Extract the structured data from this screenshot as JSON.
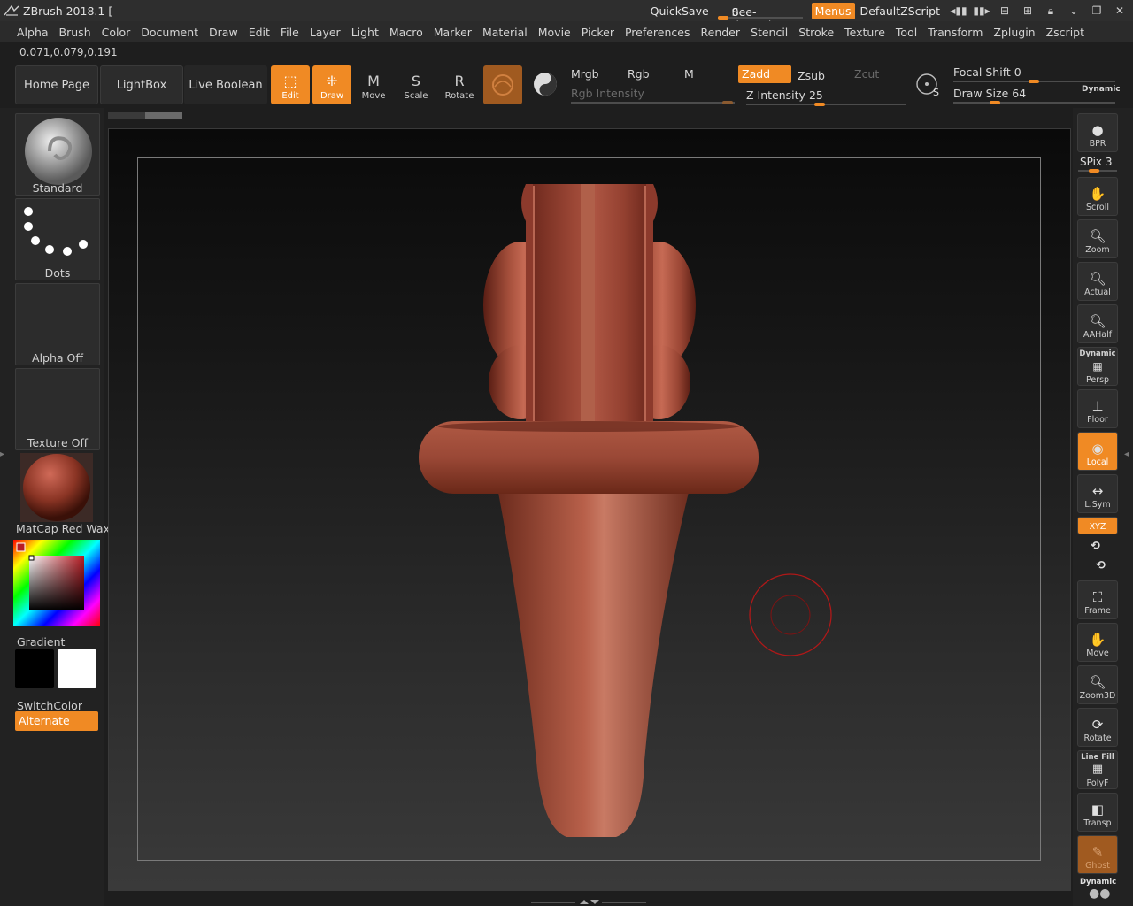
{
  "titlebar": {
    "title": "ZBrush 2018.1 [",
    "quicksave": "QuickSave",
    "seethrough_label": "See-through",
    "seethrough_value": "0",
    "menus": "Menus",
    "script": "DefaultZScript"
  },
  "menubar": [
    "Alpha",
    "Brush",
    "Color",
    "Document",
    "Draw",
    "Edit",
    "File",
    "Layer",
    "Light",
    "Macro",
    "Marker",
    "Material",
    "Movie",
    "Picker",
    "Preferences",
    "Render",
    "Stencil",
    "Stroke",
    "Texture",
    "Tool",
    "Transform",
    "Zplugin",
    "Zscript"
  ],
  "coords": "0.071,0.079,0.191",
  "shelf": {
    "home_page": "Home Page",
    "lightbox": "LightBox",
    "live_boolean": "Live Boolean",
    "edit": "Edit",
    "draw": "Draw",
    "move": "Move",
    "scale": "Scale",
    "rotate": "Rotate",
    "mrgb": "Mrgb",
    "rgb": "Rgb",
    "m": "M",
    "rgb_intensity": "Rgb Intensity",
    "zadd": "Zadd",
    "zsub": "Zsub",
    "zcut": "Zcut",
    "z_intensity_label": "Z Intensity",
    "z_intensity_value": "25",
    "focal_shift_label": "Focal Shift",
    "focal_shift_value": "0",
    "draw_size_label": "Draw Size",
    "draw_size_value": "64",
    "dynamic": "Dynamic"
  },
  "left_panel": {
    "brush": "Standard",
    "stroke": "Dots",
    "alpha": "Alpha Off",
    "texture": "Texture Off",
    "material": "MatCap Red Wax",
    "gradient": "Gradient",
    "switch_color": "SwitchColor",
    "alternate": "Alternate"
  },
  "right_panel": {
    "bpr": "BPR",
    "spix_label": "SPix",
    "spix_value": "3",
    "scroll": "Scroll",
    "zoom": "Zoom",
    "actual": "Actual",
    "aahalf": "AAHalf",
    "dynamic": "Dynamic",
    "persp": "Persp",
    "floor": "Floor",
    "local": "Local",
    "lsym": "L.Sym",
    "xyz": "XYZ",
    "frame": "Frame",
    "move": "Move",
    "zoom3d": "Zoom3D",
    "rotate": "Rotate",
    "line_fill": "Line Fill",
    "polyf": "PolyF",
    "transp": "Transp",
    "ghost": "Ghost",
    "dynamic2": "Dynamic"
  },
  "colors": {
    "accent": "#f08a24",
    "model": "#a44a38",
    "panel": "#222222"
  }
}
